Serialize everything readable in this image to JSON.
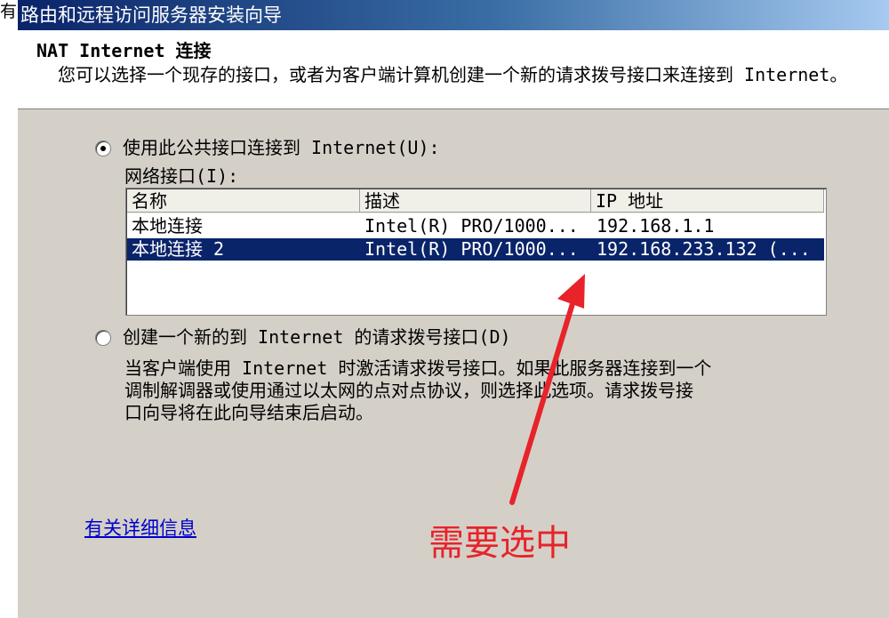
{
  "left_strip": {
    "text": "有"
  },
  "titlebar": {
    "title": "路由和远程访问服务器安装向导"
  },
  "header": {
    "title": "NAT Internet 连接",
    "description": "您可以选择一个现存的接口，或者为客户端计算机创建一个新的请求拨号接口来连接到 Internet。"
  },
  "option_public": {
    "label": "使用此公共接口连接到 Internet(U):",
    "selected": true
  },
  "network_interfaces": {
    "label": "网络接口(I):",
    "columns": [
      "名称",
      "描述",
      "IP 地址"
    ],
    "rows": [
      {
        "name": "本地连接",
        "description": "Intel(R) PRO/1000...",
        "ip": "192.168.1.1",
        "selected": false
      },
      {
        "name": "本地连接 2",
        "description": "Intel(R) PRO/1000...",
        "ip": "192.168.233.132 (...",
        "selected": true
      }
    ]
  },
  "option_new": {
    "label": "创建一个新的到 Internet 的请求拨号接口(D)",
    "selected": false,
    "description_lines": [
      "当客户端使用 Internet 时激活请求拨号接口。如果此服务器连接到一个",
      "调制解调器或使用通过以太网的点对点协议，则选择此选项。请求拨号接",
      "口向导将在此向导结束后启动。"
    ]
  },
  "more_info_link": "有关详细信息",
  "annotation": {
    "text": "需要选中",
    "color": "#e8232a"
  },
  "colors": {
    "selection": "#0a246a",
    "dialog_bg": "#d4d0c8",
    "link": "#0000cc"
  }
}
